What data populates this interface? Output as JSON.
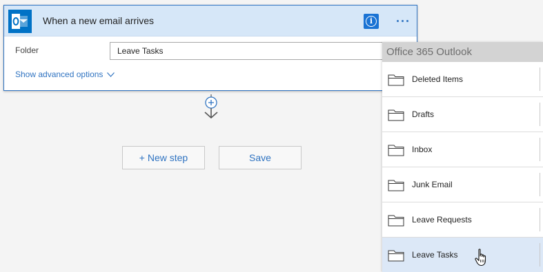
{
  "trigger_card": {
    "title": "When a new email arrives",
    "app_icon": "outlook-icon",
    "info_icon": "info-icon",
    "more_icon": "more-ellipsis-icon",
    "accent_color": "#0072c6",
    "folder_field": {
      "label": "Folder",
      "value": "Leave Tasks"
    },
    "advanced_options_label": "Show advanced options"
  },
  "connector": {
    "add_icon": "plus-circle-icon",
    "arrow_icon": "arrow-down-icon"
  },
  "actions": {
    "new_step_label": "+ New step",
    "save_label": "Save"
  },
  "folder_dropdown": {
    "header": "Office 365 Outlook",
    "items": [
      {
        "label": "Deleted Items",
        "icon": "folder-icon",
        "selected": false
      },
      {
        "label": "Drafts",
        "icon": "folder-icon",
        "selected": false
      },
      {
        "label": "Inbox",
        "icon": "folder-icon",
        "selected": false
      },
      {
        "label": "Junk Email",
        "icon": "folder-icon",
        "selected": false
      },
      {
        "label": "Leave Requests",
        "icon": "folder-icon",
        "selected": false
      },
      {
        "label": "Leave Tasks",
        "icon": "folder-icon",
        "selected": true
      }
    ]
  }
}
